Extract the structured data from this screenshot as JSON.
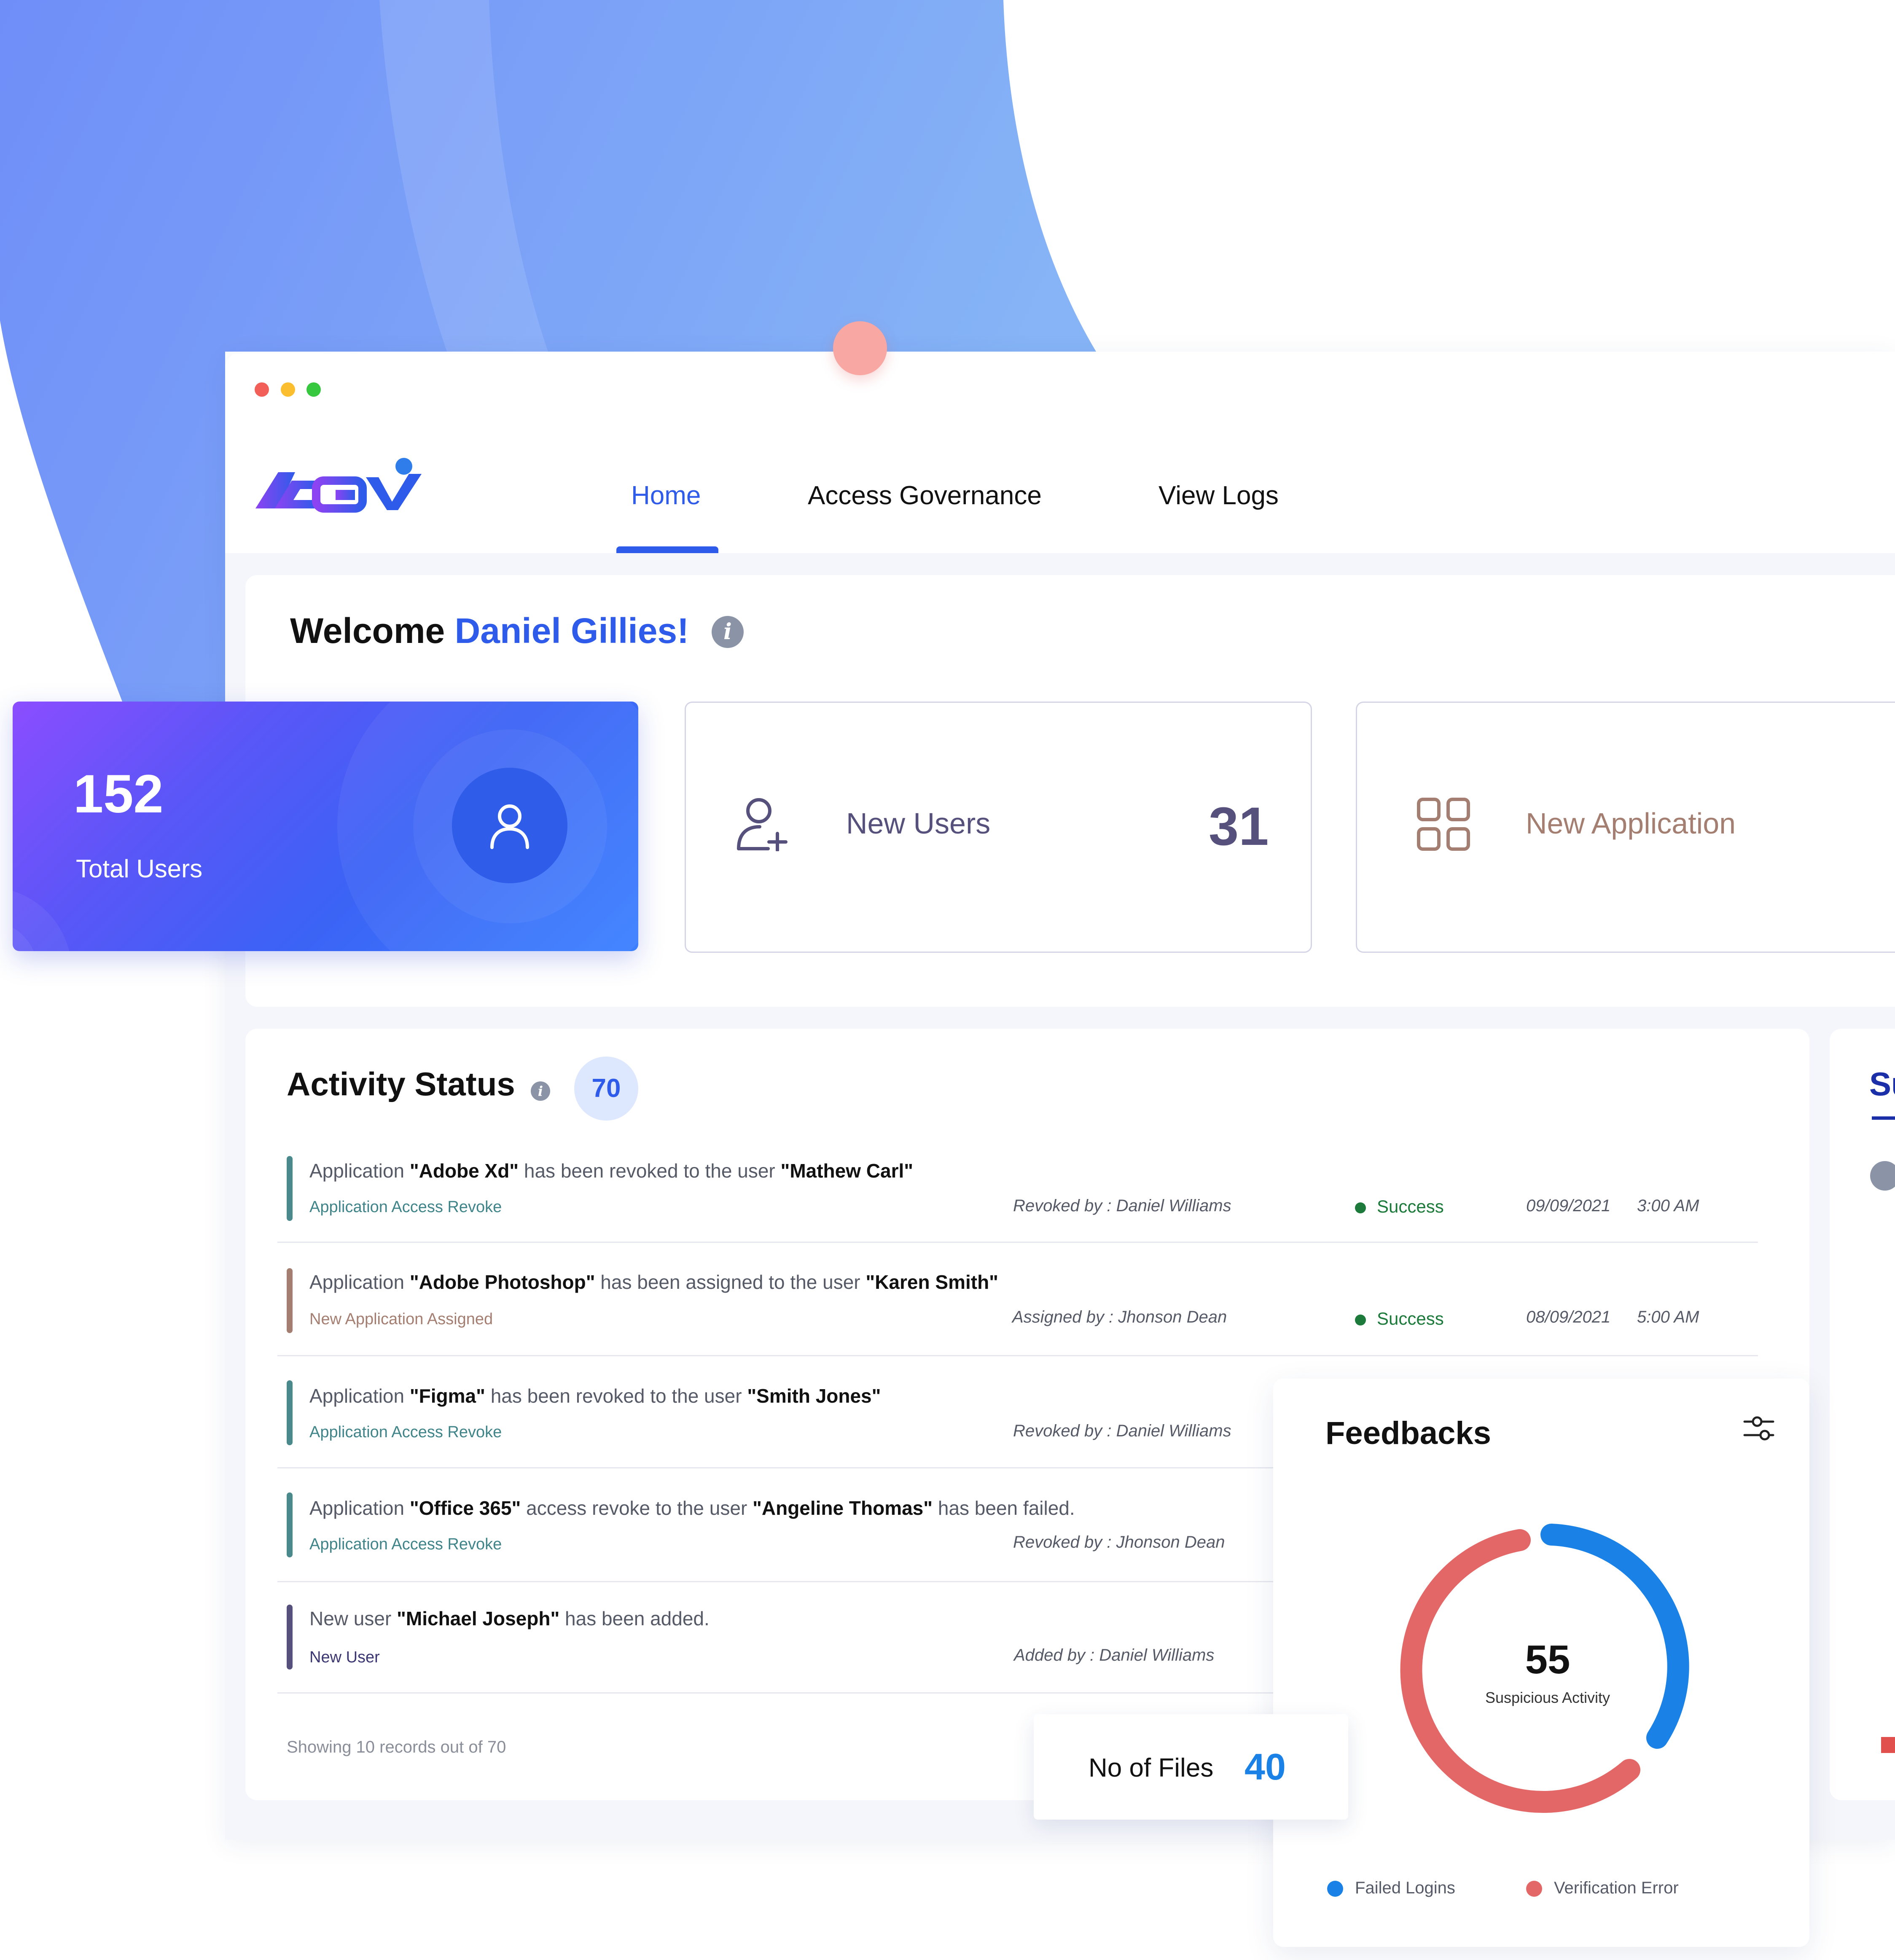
{
  "window": {
    "traffic_lights": [
      "#f25f58",
      "#fbbe2e",
      "#38c840"
    ]
  },
  "brand": {
    "logo_text": "AGOV",
    "primary_color": "#2f5bea"
  },
  "nav": {
    "items": [
      {
        "label": "Home",
        "active": true
      },
      {
        "label": "Access Governance",
        "active": false
      },
      {
        "label": "View Logs",
        "active": false
      }
    ]
  },
  "welcome": {
    "greeting": "Welcome",
    "name": "Daniel Gillies!"
  },
  "stats": {
    "total_users": {
      "value": "152",
      "label": "Total Users"
    },
    "new_users": {
      "label": "New Users",
      "value": "31"
    },
    "new_application": {
      "label": "New Application"
    }
  },
  "activity": {
    "title": "Activity Status",
    "count": "70",
    "rows": [
      {
        "pre": "Application ",
        "b1": "\"Adobe Xd\"",
        "mid": " has been revoked to the user ",
        "b2": "\"Mathew Carl\"",
        "post": "",
        "type": "Application Access Revoke",
        "by": "Revoked by : Daniel Williams",
        "status": "Success",
        "date": "09/09/2021",
        "time": "3:00 AM"
      },
      {
        "pre": "Application ",
        "b1": "\"Adobe Photoshop\"",
        "mid": " has been assigned to the user ",
        "b2": "\"Karen Smith\"",
        "post": "",
        "type": "New Application Assigned",
        "by": "Assigned  by : Jhonson Dean",
        "status": "Success",
        "date": "08/09/2021",
        "time": "5:00 AM"
      },
      {
        "pre": "Application ",
        "b1": "\"Figma\"",
        "mid": " has been revoked to the user ",
        "b2": "\"Smith Jones\"",
        "post": "",
        "type": "Application Access Revoke",
        "by": "Revoked by : Daniel Williams"
      },
      {
        "pre": "Application ",
        "b1": "\"Office 365\"",
        "mid": " access revoke to the user ",
        "b2": "\"Angeline Thomas\"",
        "post": " has been failed.",
        "type": "Application Access Revoke",
        "by": "Revoked  by : Jhonson Dean"
      },
      {
        "pre": "New user ",
        "b1": "\"Michael Joseph\"",
        "mid": " has been added.",
        "b2": "",
        "post": "",
        "type": "New User",
        "by": "Added by : Daniel Williams"
      }
    ],
    "footer": "Showing 10 records out of 70"
  },
  "files": {
    "label": "No of Files",
    "value": "40"
  },
  "feedbacks": {
    "title": "Feedbacks",
    "center_value": "55",
    "center_label": "Suspicious Activity",
    "legend": [
      {
        "label": "Failed Logins",
        "color": "#1a82e6"
      },
      {
        "label": "Verification Error",
        "color": "#e46767"
      }
    ]
  },
  "side_panel": {
    "partial_title": "Su"
  }
}
